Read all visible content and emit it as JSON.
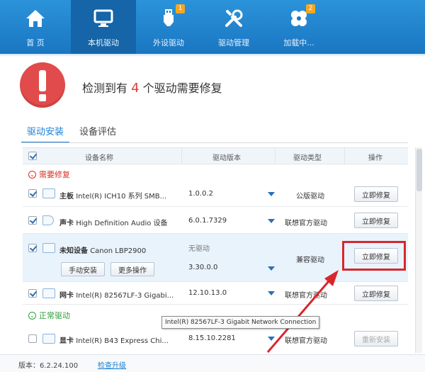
{
  "nav": {
    "items": [
      {
        "label": "首 页",
        "icon": "home-icon"
      },
      {
        "label": "本机驱动",
        "icon": "monitor-icon"
      },
      {
        "label": "外设驱动",
        "icon": "usb-icon",
        "badge": "1"
      },
      {
        "label": "驱动管理",
        "icon": "tools-icon"
      },
      {
        "label": "加载中...",
        "icon": "fan-icon",
        "badge": "2"
      }
    ],
    "active_index": 1
  },
  "alert": {
    "prefix": "检测到有 ",
    "count": "4",
    "suffix": " 个驱动需要修复"
  },
  "tabs": [
    {
      "label": "驱动安装",
      "active": true
    },
    {
      "label": "设备评估",
      "active": false
    }
  ],
  "table": {
    "headers": [
      "设备名称",
      "驱动版本",
      "驱动类型",
      "操作"
    ],
    "groups": {
      "need_fix": "需要修复",
      "normal": "正常驱动"
    },
    "rows": [
      {
        "type": "主板",
        "name": "Intel(R) ICH10 系列 SMB...",
        "version": "1.0.0.2",
        "driver_type": "公版驱动",
        "action": "立即修复"
      },
      {
        "type": "声卡",
        "name": "High Definition Audio 设备",
        "version": "6.0.1.7329",
        "driver_type": "联想官方驱动",
        "action": "立即修复"
      },
      {
        "type": "未知设备",
        "name": "Canon LBP2900",
        "version_current": "无驱动",
        "version": "3.30.0.0",
        "driver_type": "兼容驱动",
        "action": "立即修复",
        "sub_buttons": [
          "手动安装",
          "更多操作"
        ]
      },
      {
        "type": "网卡",
        "name": "Intel(R) 82567LF-3 Gigabi...",
        "version": "12.10.13.0",
        "driver_type": "联想官方驱动",
        "action": "立即修复"
      },
      {
        "type": "显卡",
        "name": "Intel(R) B43 Express Chi...",
        "version": "8.15.10.2281",
        "driver_type": "联想官方驱动",
        "action": "重新安装"
      }
    ]
  },
  "tooltip": "Intel(R) 82567LF-3 Gigabit Network Connection",
  "footer": {
    "version": "版本：6.2.24.100",
    "check_update": "检查升级"
  },
  "colors": {
    "nav_blue": "#1a76c2",
    "accent": "#1a7fd4",
    "alert_red": "#e24b4b",
    "highlight_red": "#d9262b"
  }
}
